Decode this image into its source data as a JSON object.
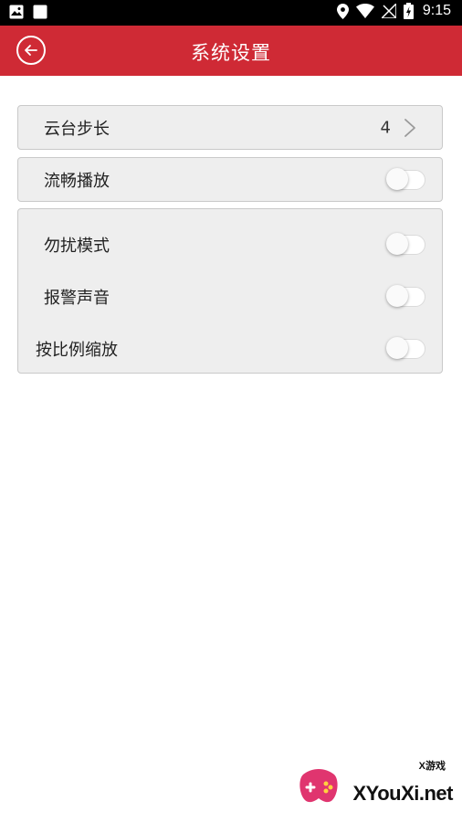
{
  "status_bar": {
    "time": "9:15"
  },
  "header": {
    "title": "系统设置",
    "back_icon": "back-arrow-circle-icon",
    "background_color": "#cf2a35"
  },
  "settings": {
    "ptz_step": {
      "label": "云台步长",
      "value": "4"
    },
    "smooth_playback": {
      "label": "流畅播放",
      "enabled": false
    },
    "do_not_disturb": {
      "label": "勿扰模式",
      "enabled": false
    },
    "alarm_sound": {
      "label": "报警声音",
      "enabled": false
    },
    "proportional_zoom": {
      "label": "按比例缩放",
      "enabled": false
    }
  },
  "watermark": {
    "brand": "XYouXi.net",
    "sub": "X游戏"
  }
}
